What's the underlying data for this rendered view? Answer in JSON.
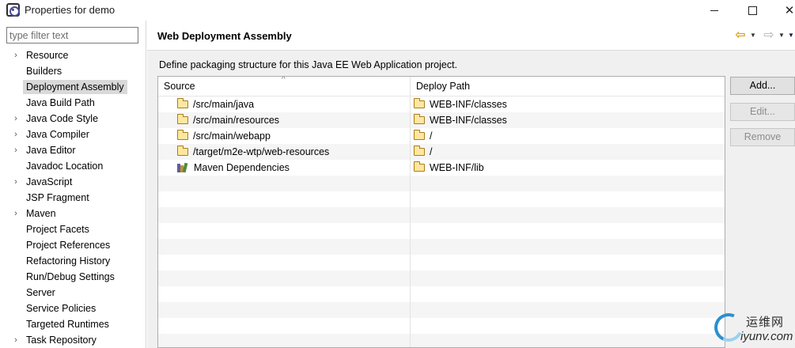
{
  "window": {
    "title": "Properties for demo",
    "controls": {
      "minimize": "minimize",
      "maximize": "maximize",
      "close": "✕"
    }
  },
  "filter": {
    "placeholder": "type filter text",
    "value": ""
  },
  "nav": {
    "items": [
      {
        "label": "Resource",
        "expandable": true,
        "selected": false
      },
      {
        "label": "Builders",
        "expandable": false,
        "selected": false
      },
      {
        "label": "Deployment Assembly",
        "expandable": false,
        "selected": true
      },
      {
        "label": "Java Build Path",
        "expandable": false,
        "selected": false
      },
      {
        "label": "Java Code Style",
        "expandable": true,
        "selected": false
      },
      {
        "label": "Java Compiler",
        "expandable": true,
        "selected": false
      },
      {
        "label": "Java Editor",
        "expandable": true,
        "selected": false
      },
      {
        "label": "Javadoc Location",
        "expandable": false,
        "selected": false
      },
      {
        "label": "JavaScript",
        "expandable": true,
        "selected": false
      },
      {
        "label": "JSP Fragment",
        "expandable": false,
        "selected": false
      },
      {
        "label": "Maven",
        "expandable": true,
        "selected": false
      },
      {
        "label": "Project Facets",
        "expandable": false,
        "selected": false
      },
      {
        "label": "Project References",
        "expandable": false,
        "selected": false
      },
      {
        "label": "Refactoring History",
        "expandable": false,
        "selected": false
      },
      {
        "label": "Run/Debug Settings",
        "expandable": false,
        "selected": false
      },
      {
        "label": "Server",
        "expandable": false,
        "selected": false
      },
      {
        "label": "Service Policies",
        "expandable": false,
        "selected": false
      },
      {
        "label": "Targeted Runtimes",
        "expandable": false,
        "selected": false
      },
      {
        "label": "Task Repository",
        "expandable": true,
        "selected": false
      }
    ]
  },
  "page": {
    "title": "Web Deployment Assembly",
    "description": "Define packaging structure for this Java EE Web Application project.",
    "back_icon": "back-arrow-icon",
    "forward_icon": "forward-arrow-icon"
  },
  "table": {
    "columns": {
      "source": "Source",
      "deploy": "Deploy Path"
    },
    "rows": [
      {
        "source": "/src/main/java",
        "source_icon": "folder",
        "deploy": "WEB-INF/classes"
      },
      {
        "source": "/src/main/resources",
        "source_icon": "folder",
        "deploy": "WEB-INF/classes"
      },
      {
        "source": "/src/main/webapp",
        "source_icon": "folder",
        "deploy": "/"
      },
      {
        "source": "/target/m2e-wtp/web-resources",
        "source_icon": "folder",
        "deploy": "/"
      },
      {
        "source": "Maven Dependencies",
        "source_icon": "library",
        "deploy": "WEB-INF/lib"
      }
    ]
  },
  "buttons": {
    "add": "Add...",
    "edit": "Edit...",
    "remove": "Remove"
  },
  "watermark": {
    "cn": "运维网",
    "url": "iyunv.com"
  },
  "colors": {
    "selected_bg": "#d9d9d9",
    "accent_arrow": "#d8a020"
  }
}
